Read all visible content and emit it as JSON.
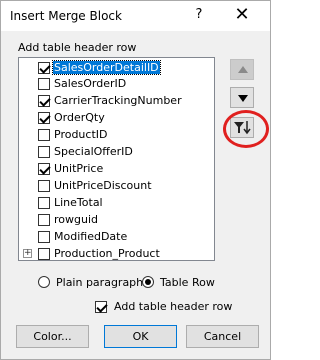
{
  "window": {
    "title": "Insert Merge Block",
    "help_label": "?",
    "close_label": "✕"
  },
  "tree": {
    "label": "Add table header row",
    "items": [
      {
        "label": "SalesOrderDetailID",
        "checked": true,
        "selected": true
      },
      {
        "label": "SalesOrderID",
        "checked": false
      },
      {
        "label": "CarrierTrackingNumber",
        "checked": true
      },
      {
        "label": "OrderQty",
        "checked": true
      },
      {
        "label": "ProductID",
        "checked": false
      },
      {
        "label": "SpecialOfferID",
        "checked": false
      },
      {
        "label": "UnitPrice",
        "checked": true
      },
      {
        "label": "UnitPriceDiscount",
        "checked": false
      },
      {
        "label": "LineTotal",
        "checked": false
      },
      {
        "label": "rowguid",
        "checked": false
      },
      {
        "label": "ModifiedDate",
        "checked": false
      },
      {
        "label": "Production_Product",
        "checked": false,
        "expandable": true,
        "expander_label": "+"
      }
    ]
  },
  "side_buttons": {
    "up_icon": "arrow-up-icon",
    "down_icon": "arrow-down-icon",
    "filter_sort_icon": "filter-sort-icon"
  },
  "options": {
    "plain_paragraph_label": "Plain paragraph",
    "table_row_label": "Table Row",
    "selected_mode": "Table Row",
    "add_header_row_label": "Add table header row",
    "add_header_row_checked": true
  },
  "buttons": {
    "color_label": "Color...",
    "ok_label": "OK",
    "cancel_label": "Cancel"
  },
  "colors": {
    "selection": "#0078d7",
    "highlight_ring": "#e0201f"
  }
}
